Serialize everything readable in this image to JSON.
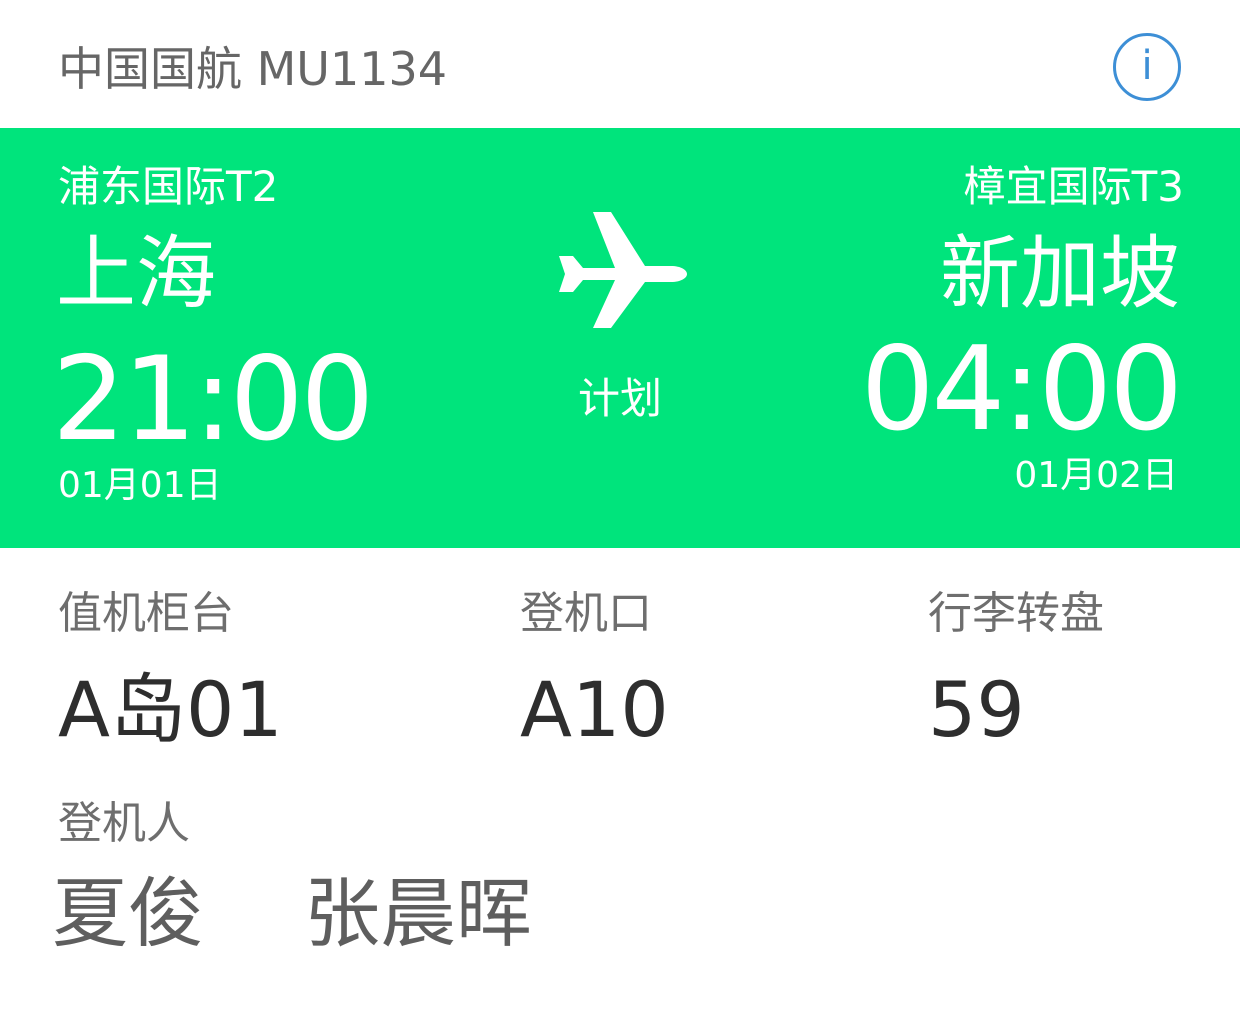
{
  "header": {
    "flight_title": "中国国航 MU1134",
    "info_icon": "info-icon",
    "info_glyph": "i",
    "info_color": "#3d8fd6"
  },
  "banner": {
    "background_color": "#00e47c",
    "departure": {
      "terminal": "浦东国际T2",
      "city": "上海",
      "time": "21:00",
      "date": "01月01日"
    },
    "arrival": {
      "terminal": "樟宜国际T3",
      "city": "新加坡",
      "time": "04:00",
      "date": "01月02日"
    },
    "plane_icon": "airplane-icon",
    "status": "计划"
  },
  "details": {
    "checkin_counter": {
      "label": "值机柜台",
      "value": "A岛01"
    },
    "gate": {
      "label": "登机口",
      "value": "A10"
    },
    "baggage_carousel": {
      "label": "行李转盘",
      "value": "59"
    },
    "passengers": {
      "label": "登机人",
      "names": [
        "夏俊",
        "张晨晖"
      ]
    }
  }
}
